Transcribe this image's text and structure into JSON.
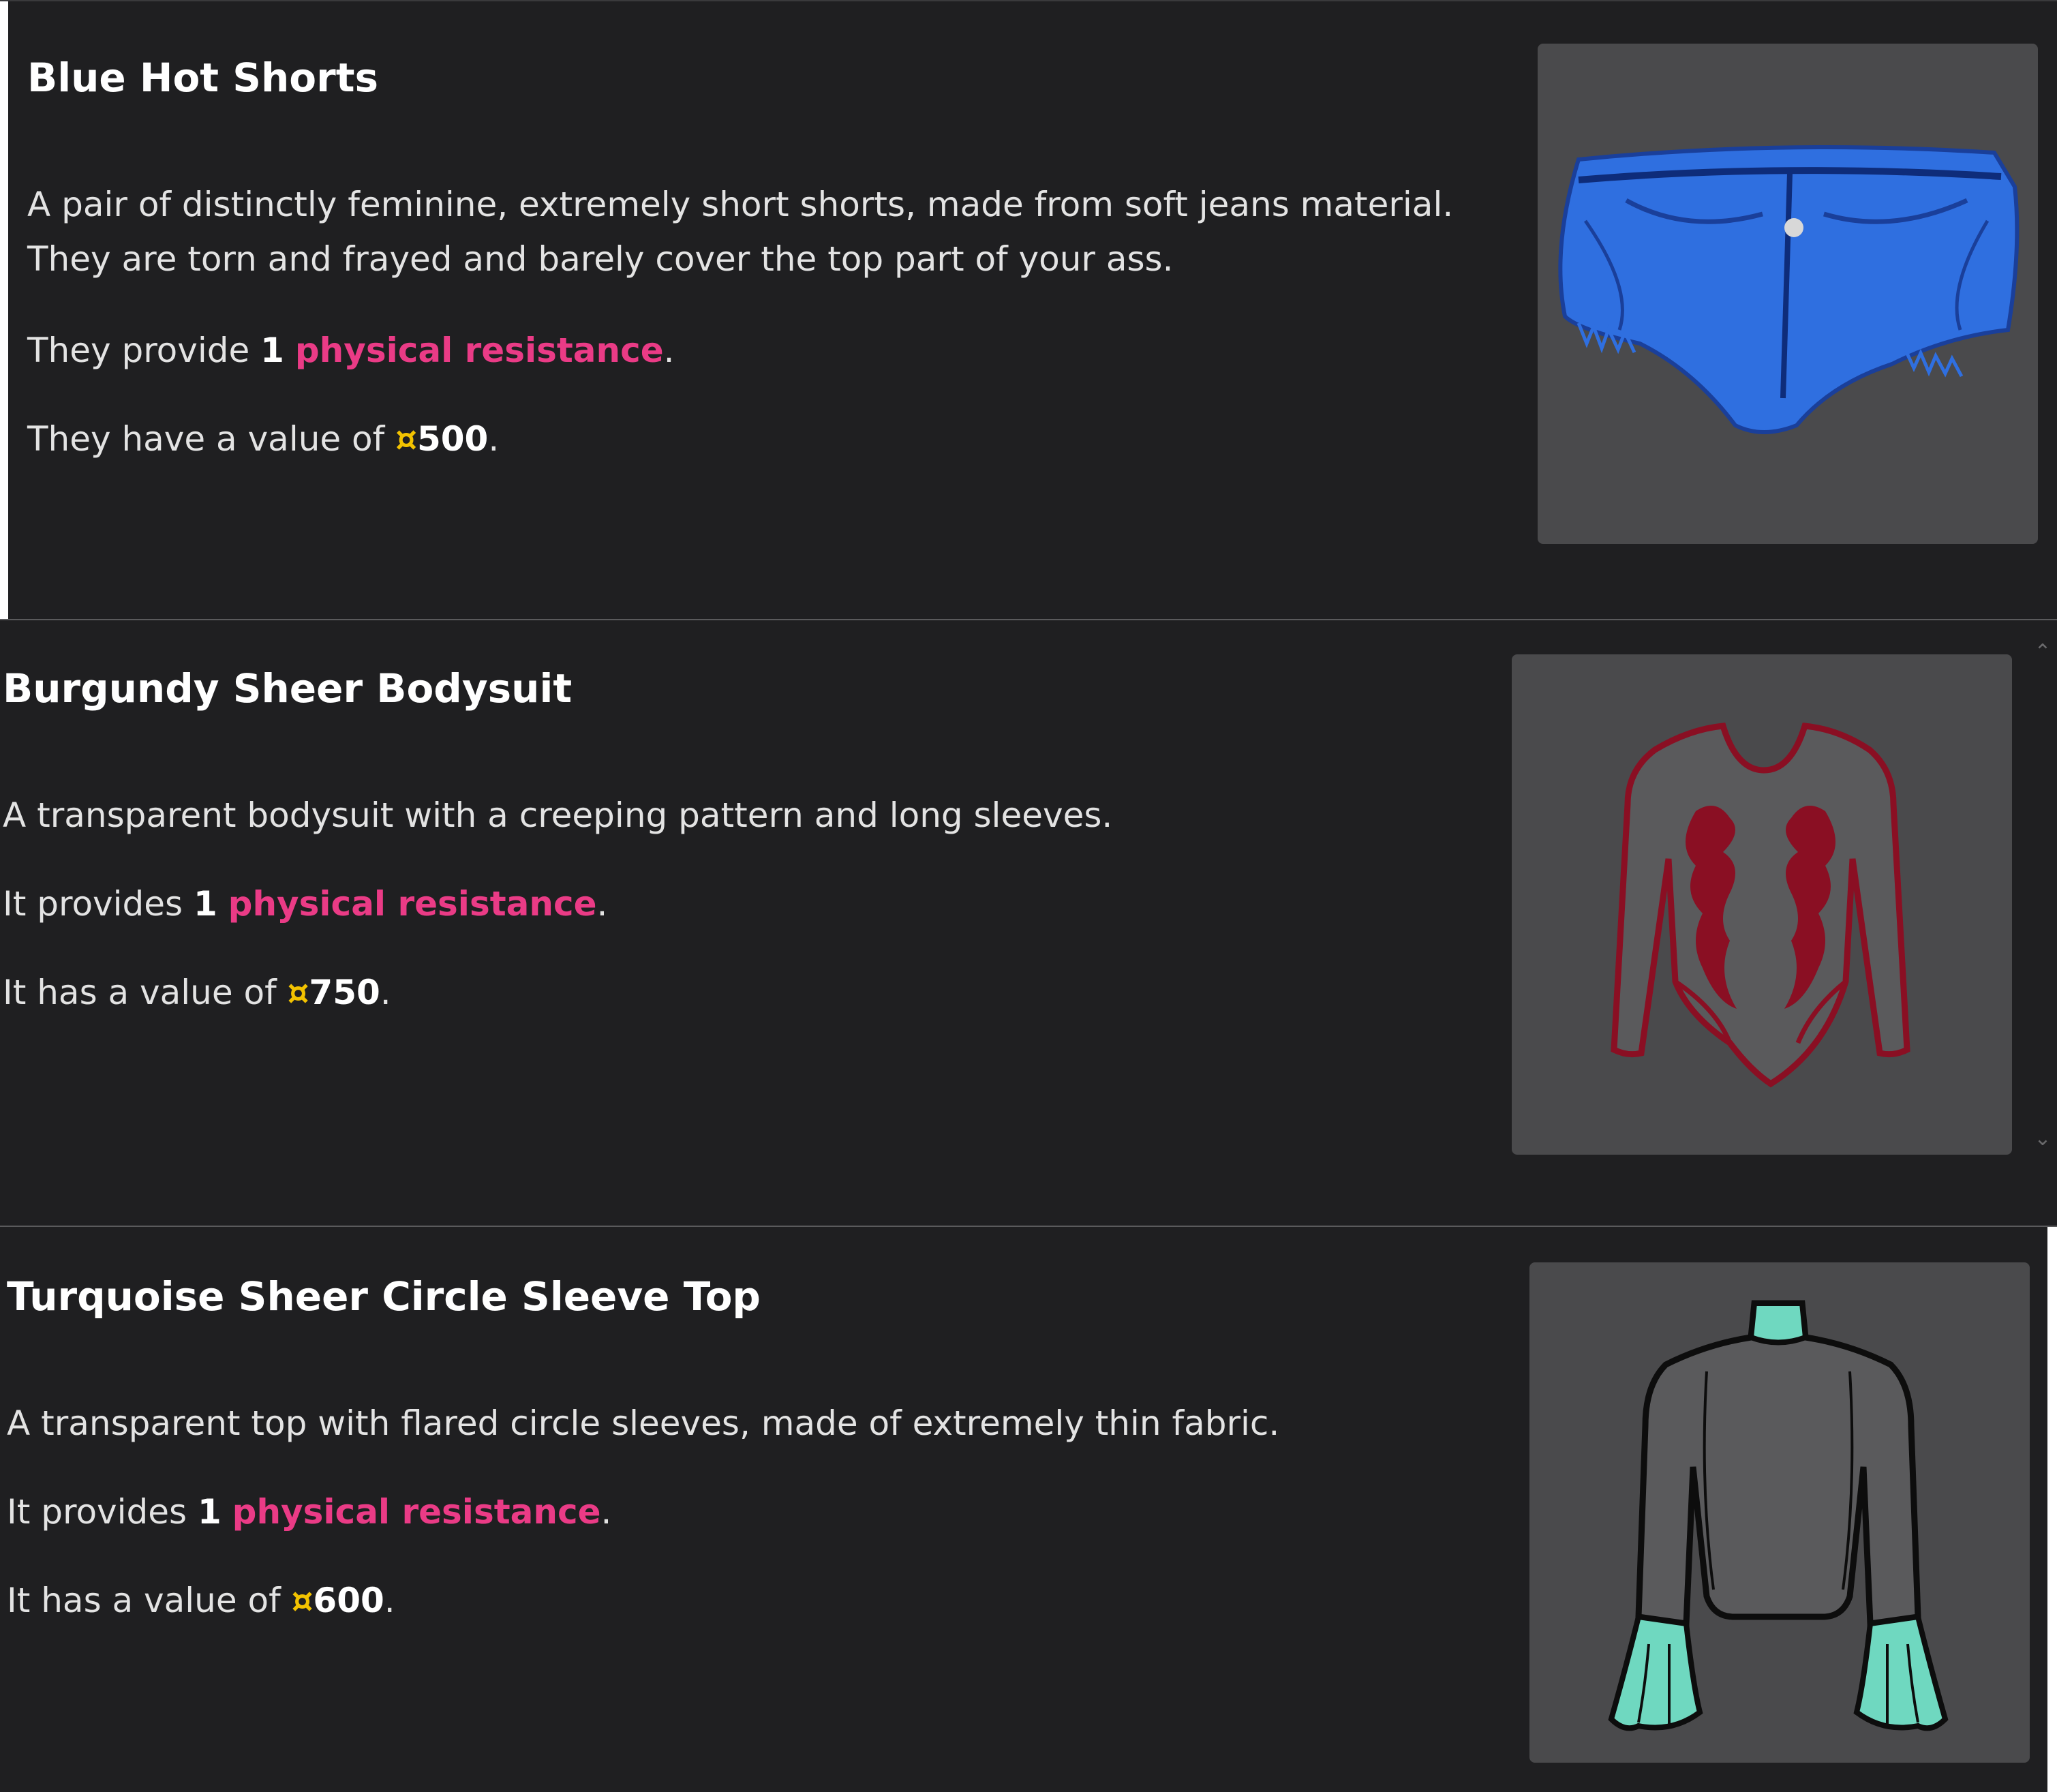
{
  "items": [
    {
      "title": "Blue Hot Shorts",
      "description_lines": [
        "A pair of distinctly feminine, extremely short shorts, made from soft jeans material.",
        "They are torn and frayed and barely cover the top part of your ass."
      ],
      "resist_prefix": "They provide ",
      "resist_amount": "1",
      "resist_type": "physical resistance",
      "value_prefix": "They have a value of ",
      "currency_symbol": "¤",
      "value_amount": "500",
      "image_icon": "denim-shorts-icon",
      "color": "#2f6fe0"
    },
    {
      "title": "Burgundy Sheer Bodysuit",
      "description_lines": [
        "A transparent bodysuit with a creeping pattern and long sleeves."
      ],
      "resist_prefix": "It provides ",
      "resist_amount": "1",
      "resist_type": "physical resistance",
      "value_prefix": "It has a value of ",
      "currency_symbol": "¤",
      "value_amount": "750",
      "image_icon": "bodysuit-icon",
      "color": "#8a0f23"
    },
    {
      "title": "Turquoise Sheer Circle Sleeve Top",
      "description_lines": [
        "A transparent top with flared circle sleeves, made of extremely thin fabric."
      ],
      "resist_prefix": "It provides ",
      "resist_amount": "1",
      "resist_type": "physical resistance",
      "value_prefix": "It has a value of ",
      "currency_symbol": "¤",
      "value_amount": "600",
      "image_icon": "circle-sleeve-top-icon",
      "color": "#6fd8c0"
    }
  ],
  "punctuation": "."
}
